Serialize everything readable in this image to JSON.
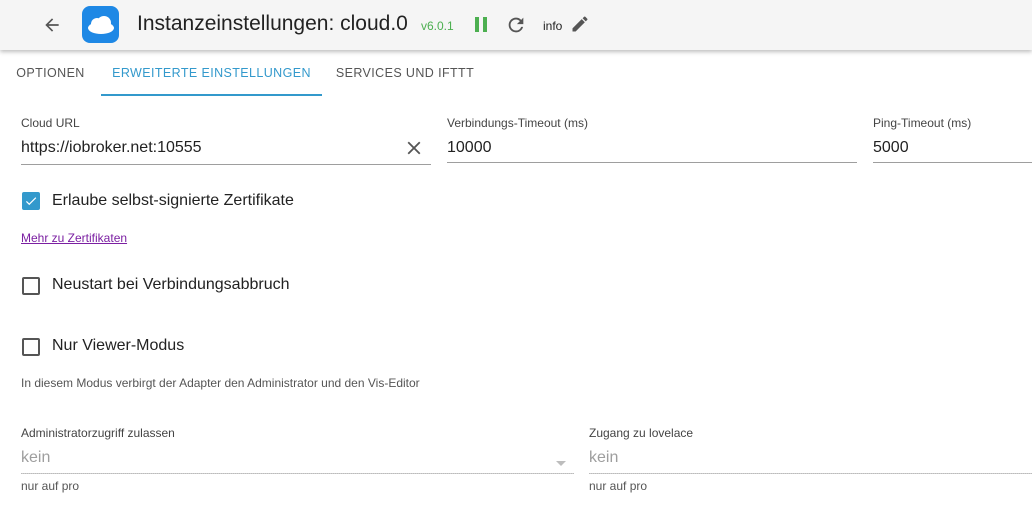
{
  "header": {
    "title": "Instanzeinstellungen: cloud.0",
    "version": "v6.0.1",
    "log_level": "info",
    "colors": {
      "logo_bg": "#1e88e5",
      "version": "#4caf50",
      "running": "#4caf50"
    },
    "icons": [
      "arrow-back-icon",
      "cloud-logo-icon",
      "pause-icon",
      "reload-icon",
      "edit-icon"
    ]
  },
  "tabs": {
    "items": [
      {
        "label": "OPTIONEN"
      },
      {
        "label": "ERWEITERTE EINSTELLUNGEN"
      },
      {
        "label": "SERVICES UND IFTTT"
      }
    ],
    "active_index": 1,
    "accent_color": "#3399cc"
  },
  "form": {
    "cloud_url": {
      "label": "Cloud URL",
      "value": "https://iobroker.net:10555"
    },
    "connect_timeout": {
      "label": "Verbindungs-Timeout (ms)",
      "value": "10000"
    },
    "ping_timeout": {
      "label": "Ping-Timeout (ms)",
      "value": "5000"
    },
    "self_signed": {
      "label": "Erlaube selbst-signierte Zertifikate",
      "checked": true
    },
    "cert_link": "Mehr zu Zertifikaten",
    "restart_on_disconnect": {
      "label": "Neustart bei Verbindungsabbruch",
      "checked": false
    },
    "viewer_mode": {
      "label": "Nur Viewer-Modus",
      "checked": false
    },
    "viewer_hint": "In diesem Modus verbirgt der Adapter den Administrator und den Vis-Editor",
    "admin_access": {
      "label": "Administratorzugriff zulassen",
      "value": "kein",
      "hint": "nur auf pro"
    },
    "lovelace_access": {
      "label": "Zugang zu lovelace",
      "value": "kein",
      "hint": "nur auf pro"
    }
  }
}
